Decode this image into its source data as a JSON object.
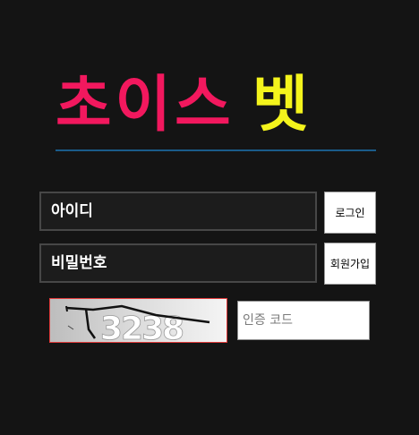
{
  "brand": {
    "name_part1": "초이스",
    "name_part2": "벳",
    "color_part1": "#f2185e",
    "color_part2": "#f4f41c",
    "divider_color": "#1a5c8a"
  },
  "login_form": {
    "id_label": "아이디",
    "password_label": "비밀번호",
    "login_button": "로그인",
    "signup_button": "회원가입"
  },
  "captcha": {
    "code": "3238",
    "input_placeholder": "인증 코드"
  }
}
